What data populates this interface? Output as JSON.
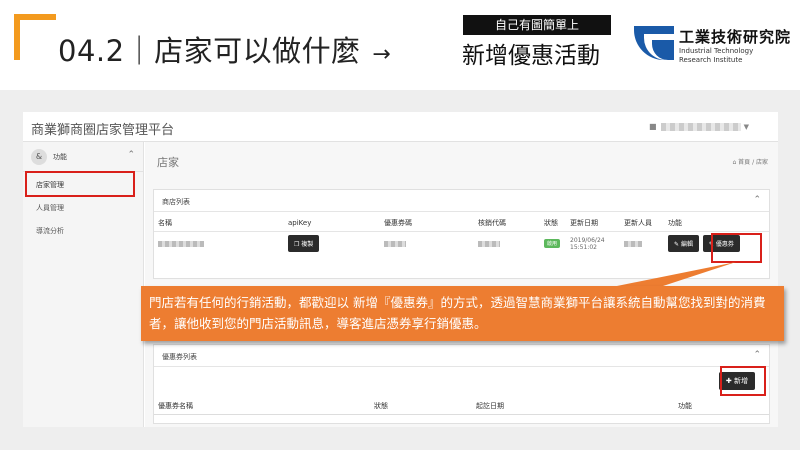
{
  "slide": {
    "title": "04.2｜店家可以做什麼",
    "arrow": "→",
    "subtitle": "新增優惠活動",
    "tag": "自己有圖簡單上",
    "logo_zh": "工業技術研究院",
    "logo_en1": "Industrial Technology",
    "logo_en2": "Research Institute"
  },
  "app": {
    "title": "商業獅商圈店家管理平台",
    "sidebar": {
      "head_label": "功能",
      "items": [
        {
          "label": "店家管理"
        },
        {
          "label": "人員管理"
        },
        {
          "label": "導流分析"
        }
      ]
    },
    "main": {
      "title": "店家",
      "breadcrumb": "首頁 / 店家"
    },
    "store_panel": {
      "title": "商店列表",
      "columns": [
        "名稱",
        "apiKey",
        "優惠券碼",
        "核銷代碼",
        "狀態",
        "更新日期",
        "更新人員",
        "功能"
      ],
      "row": {
        "copy_label": "複製",
        "status": "啟用",
        "date": "2019/06/24",
        "time": "15:51:02",
        "edit_label": "編輯",
        "coupon_label": "優惠券"
      }
    },
    "coupon_panel": {
      "title": "優惠券列表",
      "add_label": "新增",
      "columns": [
        "優惠券名稱",
        "狀態",
        "起訖日期",
        "功能"
      ]
    }
  },
  "callout": {
    "text": "門店若有任何的行銷活動，都歡迎以 新增『優惠券』的方式，透過智慧商業獅平台讓系統自動幫您找到對的消費者，讓他收到您的門店活動訊息，導客進店憑券享行銷優惠。"
  },
  "colors": {
    "accent_orange": "#ed7d31",
    "corner_orange": "#f39a1e",
    "highlight_red": "#d9201a",
    "logo_blue": "#1a5aa8"
  }
}
